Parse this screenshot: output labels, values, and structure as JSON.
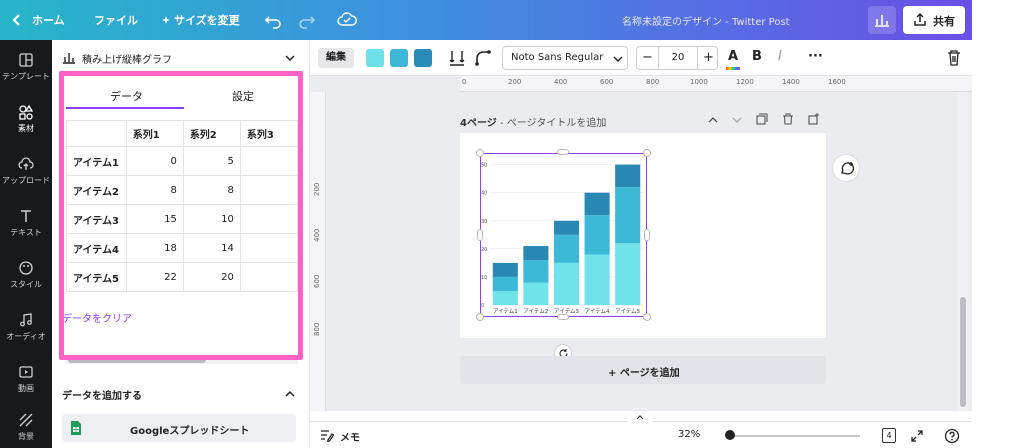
{
  "topbar": {
    "home": "ホーム",
    "file": "ファイル",
    "resize": "サイズを変更",
    "design_title": "名称未設定のデザイン - Twitter Post",
    "share": "共有"
  },
  "rail": {
    "items": [
      {
        "label": "テンプレート"
      },
      {
        "label": "素材"
      },
      {
        "label": "アップロード"
      },
      {
        "label": "テキスト"
      },
      {
        "label": "スタイル"
      },
      {
        "label": "オーディオ"
      },
      {
        "label": "動画"
      },
      {
        "label": "背景"
      }
    ]
  },
  "panel": {
    "title": "積み上げ縦棒グラフ",
    "tabs": {
      "data": "データ",
      "settings": "設定"
    },
    "table": {
      "headers": [
        "",
        "系列1",
        "系列2",
        "系列3"
      ],
      "rows": [
        {
          "label": "アイテム1",
          "v1": "0",
          "v2": "5",
          "v3": ""
        },
        {
          "label": "アイテム2",
          "v1": "8",
          "v2": "8",
          "v3": ""
        },
        {
          "label": "アイテム3",
          "v1": "15",
          "v2": "10",
          "v3": ""
        },
        {
          "label": "アイテム4",
          "v1": "18",
          "v2": "14",
          "v3": ""
        },
        {
          "label": "アイテム5",
          "v1": "22",
          "v2": "20",
          "v3": ""
        }
      ]
    },
    "clear_data": "データをクリア",
    "add_data": "データを追加する",
    "google_sheets": "Googleスプレッドシート"
  },
  "toolbar": {
    "edit": "編集",
    "colors": [
      "#6ee0e8",
      "#3fb8d8",
      "#2a8ab8"
    ],
    "font": "Noto Sans Regular",
    "font_size": "20",
    "font_size_minus": "−",
    "font_size_plus": "+",
    "text_color_glyph": "A",
    "bold_glyph": "B",
    "italic_glyph": "I",
    "more_glyph": "···"
  },
  "canvas": {
    "ruler_top": [
      "0",
      "200",
      "400",
      "600",
      "800",
      "1000",
      "1200",
      "1400",
      "1600"
    ],
    "ruler_left": [
      "200",
      "400",
      "600",
      "800"
    ],
    "page_number": "4ページ",
    "page_title_placeholder": "- ページタイトルを追加",
    "add_page": "+ ページを追加"
  },
  "chart_data": {
    "type": "bar",
    "stacked": true,
    "categories": [
      "アイテム1",
      "アイテム2",
      "アイテム3",
      "アイテム4",
      "アイテム5"
    ],
    "series": [
      {
        "values": [
          5,
          8,
          15,
          18,
          22
        ],
        "color": "#6fe3ea"
      },
      {
        "values": [
          5,
          8,
          10,
          14,
          20
        ],
        "color": "#3db8d6"
      },
      {
        "values": [
          5,
          5,
          5,
          8,
          8
        ],
        "color": "#2a89b4"
      }
    ],
    "yticks": [
      "0",
      "10",
      "20",
      "30",
      "40",
      "50"
    ],
    "ylim": [
      0,
      52
    ],
    "grid": true
  },
  "bottombar": {
    "memo": "メモ",
    "zoom": "32%",
    "zoom_fraction": 0.02,
    "pages": "4"
  }
}
